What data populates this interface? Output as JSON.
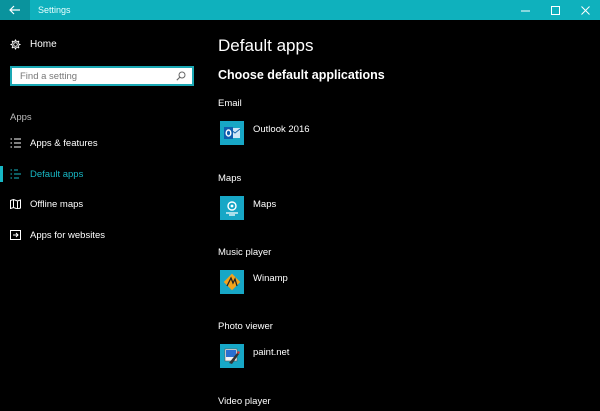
{
  "titlebar": {
    "title": "Settings"
  },
  "sidebar": {
    "home_label": "Home",
    "search_placeholder": "Find a setting",
    "section_label": "Apps",
    "items": [
      {
        "label": "Apps & features",
        "icon": "list-icon"
      },
      {
        "label": "Default apps",
        "icon": "default-apps-icon",
        "active": true
      },
      {
        "label": "Offline maps",
        "icon": "map-icon"
      },
      {
        "label": "Apps for websites",
        "icon": "open-in-icon"
      }
    ]
  },
  "main": {
    "title": "Default apps",
    "subtitle": "Choose default applications",
    "categories": [
      {
        "label": "Email",
        "app": "Outlook 2016",
        "icon": "outlook-icon"
      },
      {
        "label": "Maps",
        "app": "Maps",
        "icon": "maps-icon"
      },
      {
        "label": "Music player",
        "app": "Winamp",
        "icon": "winamp-icon"
      },
      {
        "label": "Photo viewer",
        "app": "paint.net",
        "icon": "paintnet-icon"
      },
      {
        "label": "Video player"
      }
    ]
  },
  "colors": {
    "accent": "#17b7c4",
    "titlebar": "#0fb1bd",
    "tile": "#17a7c6",
    "background": "#000000"
  }
}
